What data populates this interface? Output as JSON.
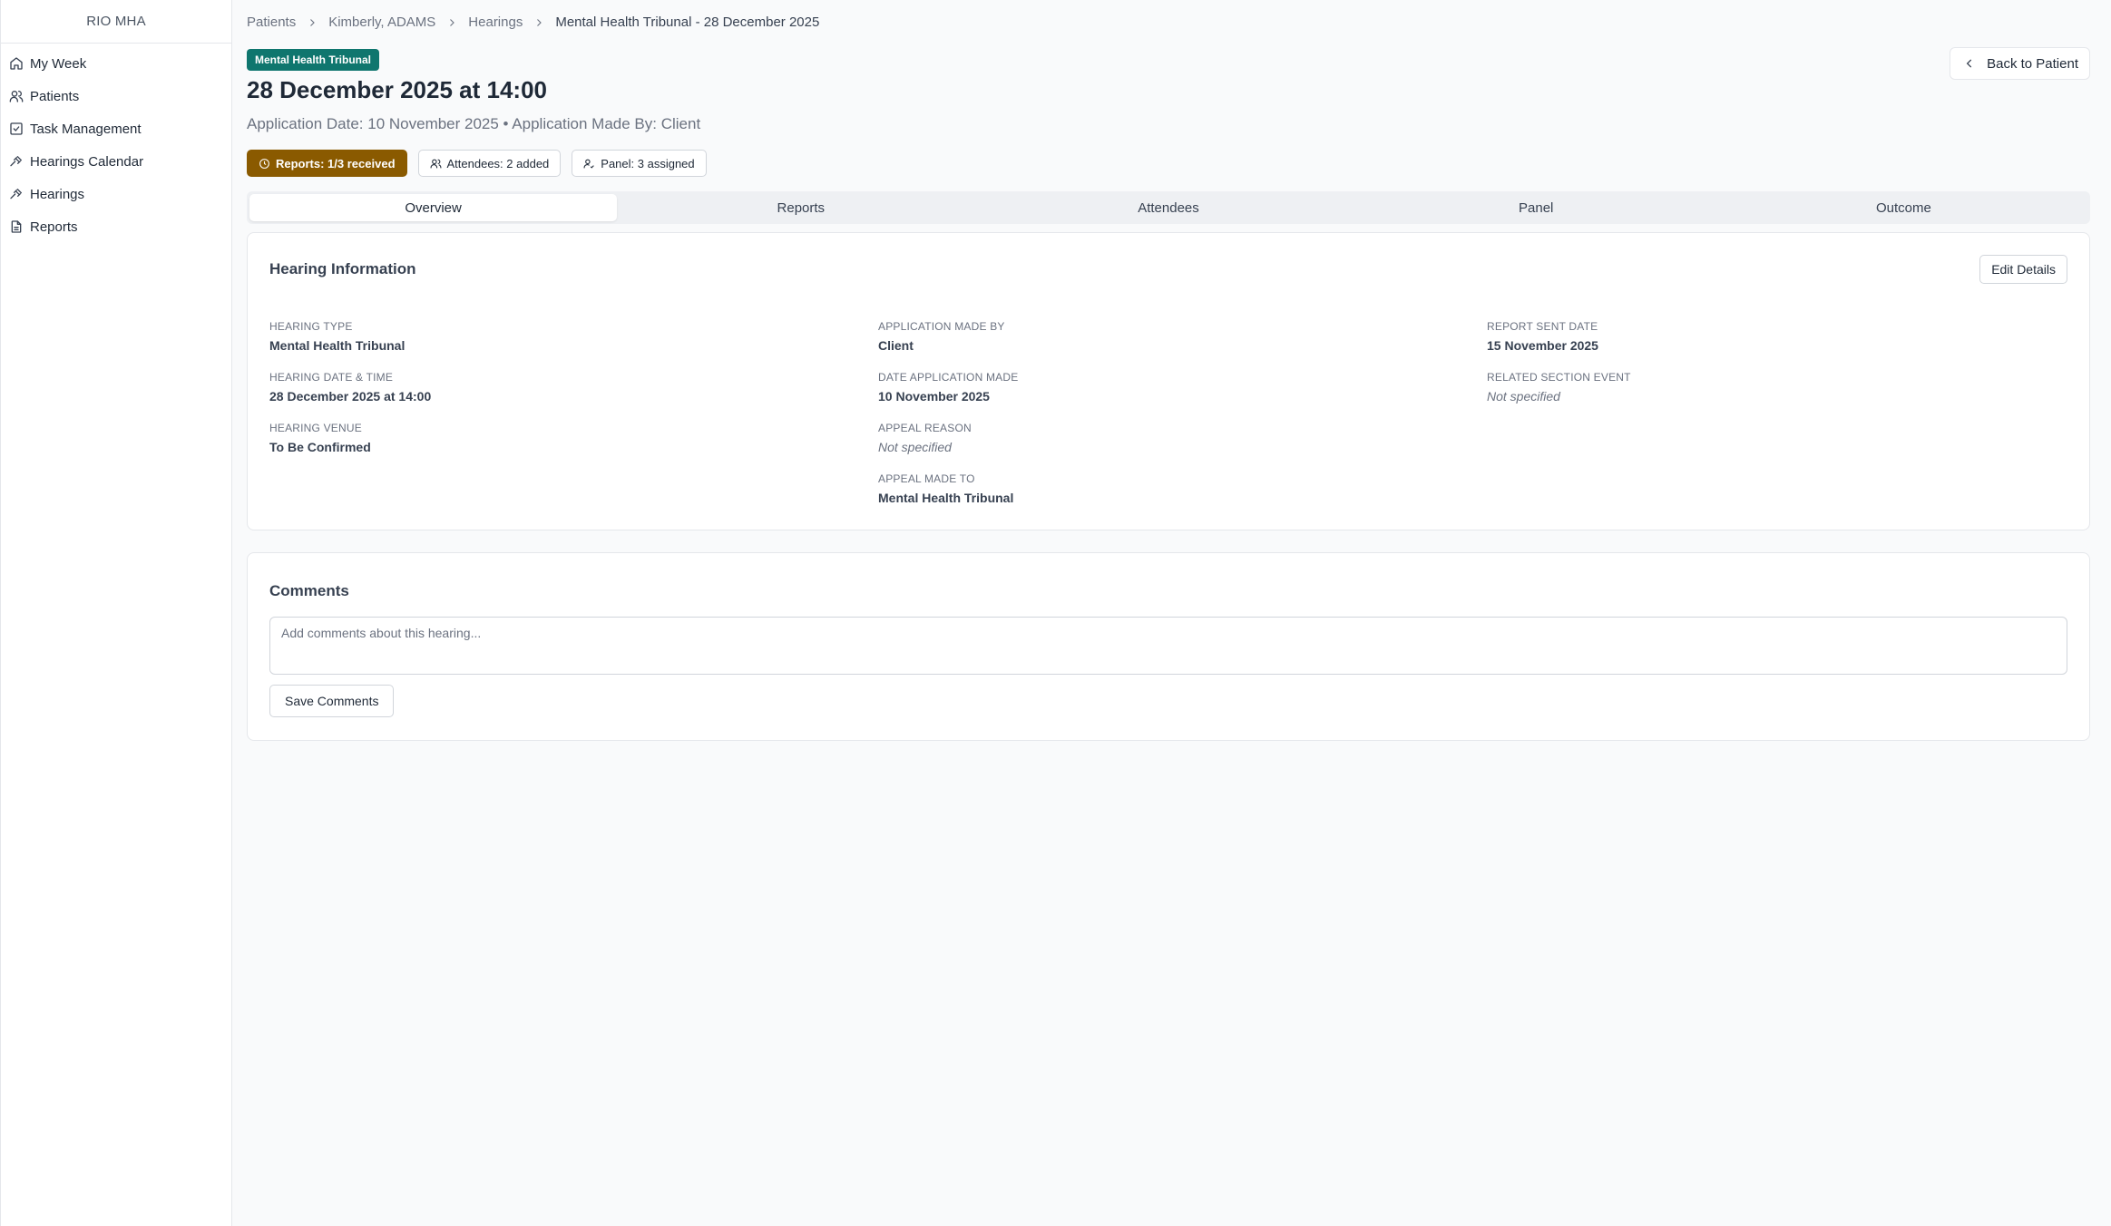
{
  "app": {
    "title": "RIO MHA"
  },
  "sidebar": {
    "items": [
      {
        "label": "My Week",
        "icon": "home-icon"
      },
      {
        "label": "Patients",
        "icon": "users-icon"
      },
      {
        "label": "Task Management",
        "icon": "checkbox-icon"
      },
      {
        "label": "Hearings Calendar",
        "icon": "gavel-icon"
      },
      {
        "label": "Hearings",
        "icon": "gavel-icon"
      },
      {
        "label": "Reports",
        "icon": "document-icon"
      }
    ]
  },
  "breadcrumb": {
    "items": [
      "Patients",
      "Kimberly, ADAMS",
      "Hearings",
      "Mental Health Tribunal - 28 December 2025"
    ]
  },
  "header": {
    "type_badge": "Mental Health Tribunal",
    "title": "28 December 2025 at 14:00",
    "subtitle": "Application Date: 10 November 2025 • Application Made By: Client",
    "back_label": "Back to Patient",
    "badge_color": "#0f766e"
  },
  "chips": {
    "reports": "Reports: 1/3 received",
    "attendees": "Attendees: 2 added",
    "panel": "Panel: 3 assigned",
    "reports_color": "#8a5a00"
  },
  "tabs": [
    {
      "label": "Overview",
      "active": true
    },
    {
      "label": "Reports",
      "active": false
    },
    {
      "label": "Attendees",
      "active": false
    },
    {
      "label": "Panel",
      "active": false
    },
    {
      "label": "Outcome",
      "active": false
    }
  ],
  "hearing_info": {
    "title": "Hearing Information",
    "edit_label": "Edit Details",
    "col1": [
      {
        "label": "Hearing Type",
        "value": "Mental Health Tribunal"
      },
      {
        "label": "Hearing Date & Time",
        "value": "28 December 2025 at 14:00"
      },
      {
        "label": "Hearing Venue",
        "value": "To Be Confirmed"
      }
    ],
    "col2": [
      {
        "label": "Application Made By",
        "value": "Client"
      },
      {
        "label": "Date Application Made",
        "value": "10 November 2025"
      },
      {
        "label": "Appeal Reason",
        "value": "Not specified"
      },
      {
        "label": "Appeal Made To",
        "value": "Mental Health Tribunal"
      }
    ],
    "col3": [
      {
        "label": "Report Sent Date",
        "value": "15 November 2025"
      },
      {
        "label": "Related Section Event",
        "value": "Not specified"
      }
    ]
  },
  "comments": {
    "title": "Comments",
    "placeholder": "Add comments about this hearing...",
    "value": "",
    "save_label": "Save Comments"
  }
}
